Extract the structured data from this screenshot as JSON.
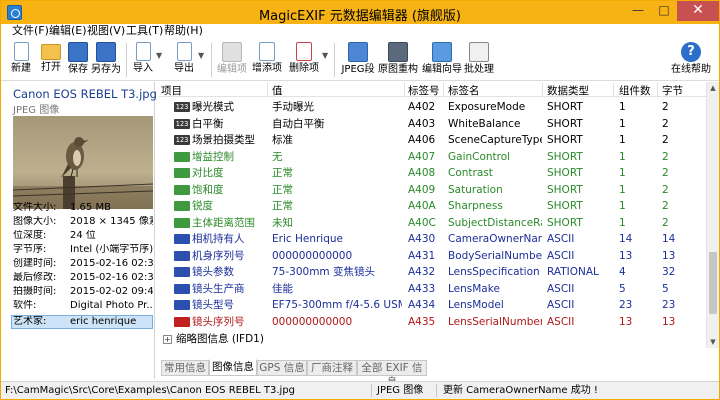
{
  "window": {
    "title": "MagicEXIF 元数据编辑器 (旗舰版)"
  },
  "menu": [
    {
      "label": "文件(F)"
    },
    {
      "label": "编辑(E)"
    },
    {
      "label": "视图(V)"
    },
    {
      "label": "工具(T)"
    },
    {
      "label": "帮助(H)"
    }
  ],
  "toolbar": {
    "new": "新建",
    "open": "打开",
    "save": "保存",
    "save_as": "另存为",
    "import": "导入",
    "export": "导出",
    "edit_item": "编辑项",
    "add_item": "增添项",
    "delete_item": "删除项",
    "jpeg_segment": "JPEG段",
    "rebuild": "原图重构",
    "wizard": "编辑向导",
    "batch": "批处理",
    "help": "在线帮助"
  },
  "image_panel": {
    "camera_name": "Canon EOS REBEL T3.jpg",
    "file_type": "JPEG 图像",
    "info": [
      {
        "key": "文件大小:",
        "value": "1.65 MB"
      },
      {
        "key": "图像大小:",
        "value": "2018 × 1345 像素"
      },
      {
        "key": "位深度:",
        "value": "24 位"
      },
      {
        "key": "字节序:",
        "value": "Intel (小端字节序)"
      },
      {
        "key": "创建时间:",
        "value": "2015-02-16 02:3..."
      },
      {
        "key": "最后修改:",
        "value": "2015-02-16 02:3..."
      },
      {
        "key": "拍摄时间:",
        "value": "2015-02-02 09:4..."
      },
      {
        "key": "软件:",
        "value": "Digital Photo Pr..."
      },
      {
        "key": "艺术家:",
        "value": "eric henrique"
      }
    ]
  },
  "grid": {
    "columns": [
      "项目",
      "值",
      "标签号",
      "标签名",
      "数据类型",
      "组件数",
      "字节"
    ],
    "rows": [
      {
        "icon": "123",
        "item": "曝光模式",
        "value": "手动曝光",
        "tag": "A402",
        "tag_name": "ExposureMode",
        "type": "SHORT",
        "count": "1",
        "bytes": "2"
      },
      {
        "icon": "123",
        "item": "白平衡",
        "value": "自动白平衡",
        "tag": "A403",
        "tag_name": "WhiteBalance",
        "type": "SHORT",
        "count": "1",
        "bytes": "2"
      },
      {
        "icon": "123",
        "item": "场景拍摄类型",
        "value": "标准",
        "tag": "A406",
        "tag_name": "SceneCaptureType",
        "type": "SHORT",
        "count": "1",
        "bytes": "2"
      },
      {
        "icon": "CTRL",
        "item": "增益控制",
        "value": "无",
        "tag": "A407",
        "tag_name": "GainControl",
        "type": "SHORT",
        "count": "1",
        "bytes": "2"
      },
      {
        "icon": "CTRL",
        "item": "对比度",
        "value": "正常",
        "tag": "A408",
        "tag_name": "Contrast",
        "type": "SHORT",
        "count": "1",
        "bytes": "2"
      },
      {
        "icon": "CTRL",
        "item": "饱和度",
        "value": "正常",
        "tag": "A409",
        "tag_name": "Saturation",
        "type": "SHORT",
        "count": "1",
        "bytes": "2"
      },
      {
        "icon": "CTRL",
        "item": "锐度",
        "value": "正常",
        "tag": "A40A",
        "tag_name": "Sharpness",
        "type": "SHORT",
        "count": "1",
        "bytes": "2"
      },
      {
        "icon": "CTRL",
        "item": "主体距离范围",
        "value": "未知",
        "tag": "A40C",
        "tag_name": "SubjectDistanceRange",
        "type": "SHORT",
        "count": "1",
        "bytes": "2"
      },
      {
        "icon": "TXT",
        "item": "相机持有人",
        "value": "Eric Henrique",
        "tag": "A430",
        "tag_name": "CameraOwnerName",
        "type": "ASCII",
        "count": "14",
        "bytes": "14"
      },
      {
        "icon": "TXT",
        "item": "机身序列号",
        "value": "000000000000",
        "tag": "A431",
        "tag_name": "BodySerialNumber",
        "type": "ASCII",
        "count": "13",
        "bytes": "13"
      },
      {
        "icon": "TXT",
        "item": "镜头参数",
        "value": "75-300mm 变焦镜头",
        "tag": "A432",
        "tag_name": "LensSpecification",
        "type": "RATIONAL",
        "count": "4",
        "bytes": "32"
      },
      {
        "icon": "TXT",
        "item": "镜头生产商",
        "value": "佳能",
        "tag": "A433",
        "tag_name": "LensMake",
        "type": "ASCII",
        "count": "5",
        "bytes": "5"
      },
      {
        "icon": "TXT",
        "item": "镜头型号",
        "value": "EF75-300mm f/4-5.6 USM",
        "tag": "A434",
        "tag_name": "LensModel",
        "type": "ASCII",
        "count": "23",
        "bytes": "23"
      },
      {
        "icon": "ERR",
        "item": "镜头序列号",
        "value": "000000000000",
        "tag": "A435",
        "tag_name": "LensSerialNumber",
        "type": "ASCII",
        "count": "13",
        "bytes": "13"
      }
    ],
    "tree_label": "缩略图信息 (IFD1)"
  },
  "colors": {
    "title_bar": "#f7b313",
    "row_normal": "#000000",
    "row_green": "#2a8a2a",
    "row_blue": "#1c2f9a",
    "row_red": "#b01818",
    "selection": "#cde3f7"
  },
  "tabs": [
    {
      "label": "常用信息",
      "active": false
    },
    {
      "label": "图像信息",
      "active": true
    },
    {
      "label": "GPS 信息",
      "active": false
    },
    {
      "label": "厂商注释",
      "active": false
    },
    {
      "label": "全部 EXIF 信息",
      "active": false
    }
  ],
  "status": {
    "path": "F:\\CamMagic\\Src\\Core\\Examples\\Canon EOS REBEL T3.jpg",
    "type": "JPEG 图像",
    "message": "更新 CameraOwnerName 成功 !"
  }
}
